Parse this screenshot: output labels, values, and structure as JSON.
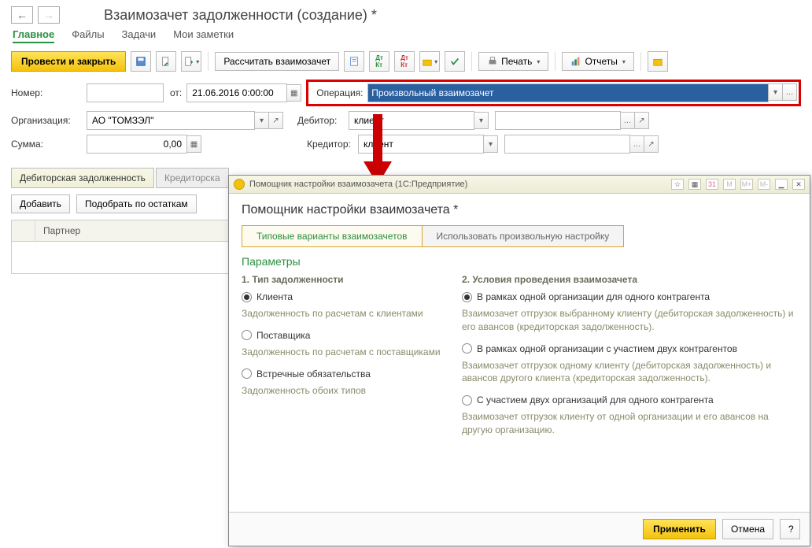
{
  "header": {
    "title": "Взаимозачет задолженности (создание) *"
  },
  "nav_tabs": [
    "Главное",
    "Файлы",
    "Задачи",
    "Мои заметки"
  ],
  "toolbar": {
    "post_and_close": "Провести и закрыть",
    "calc_offset": "Рассчитать взаимозачет",
    "print": "Печать",
    "reports": "Отчеты"
  },
  "form": {
    "number_label": "Номер:",
    "number_value": "",
    "date_label": "от:",
    "date_value": "21.06.2016 0:00:00",
    "org_label": "Организация:",
    "org_value": "АО \"ТОМЗЭЛ\"",
    "sum_label": "Сумма:",
    "sum_value": "0,00",
    "operation_label": "Операция:",
    "operation_value": "Произвольный взаимозачет",
    "debtor_label": "Дебитор:",
    "debtor_value": "клиент",
    "creditor_label": "Кредитор:",
    "creditor_value": "клиент"
  },
  "sub_tabs": [
    "Дебиторская задолженность",
    "Кредиторска"
  ],
  "sub_toolbar": {
    "add": "Добавить",
    "pick": "Подобрать по остаткам"
  },
  "table": {
    "col_partner": "Партнер"
  },
  "popup": {
    "app_title": "Помощник настройки взаимозачета  (1С:Предприятие)",
    "heading": "Помощник настройки взаимозачета *",
    "mode_typical": "Типовые варианты взаимозачетов",
    "mode_custom": "Использовать произвольную настройку",
    "params_h": "Параметры",
    "col1_h": "1. Тип задолженности",
    "col2_h": "2. Условия проведения взаимозачета",
    "r1": "Клиента",
    "r1_desc": "Задолженность по расчетам с клиентами",
    "r2": "Поставщика",
    "r2_desc": "Задолженность по расчетам с поставщиками",
    "r3": "Встречные обязательства",
    "r3_desc": "Задолженность обоих типов",
    "c1": "В рамках одной организации для одного контрагента",
    "c1_desc": "Взаимозачет отгрузок выбранному клиенту (дебиторская задолженность) и его авансов (кредиторская задолженность).",
    "c2": "В рамках одной организации с участием двух контрагентов",
    "c2_desc": "Взаимозачет отгрузок одному клиенту (дебиторская задолженность) и авансов другого клиента (кредиторская задолженность).",
    "c3": "С участием двух организаций для одного контрагента",
    "c3_desc": "Взаимозачет отгрузок клиенту от одной организации и его авансов на другую организацию.",
    "apply": "Применить",
    "cancel": "Отмена",
    "help": "?"
  }
}
